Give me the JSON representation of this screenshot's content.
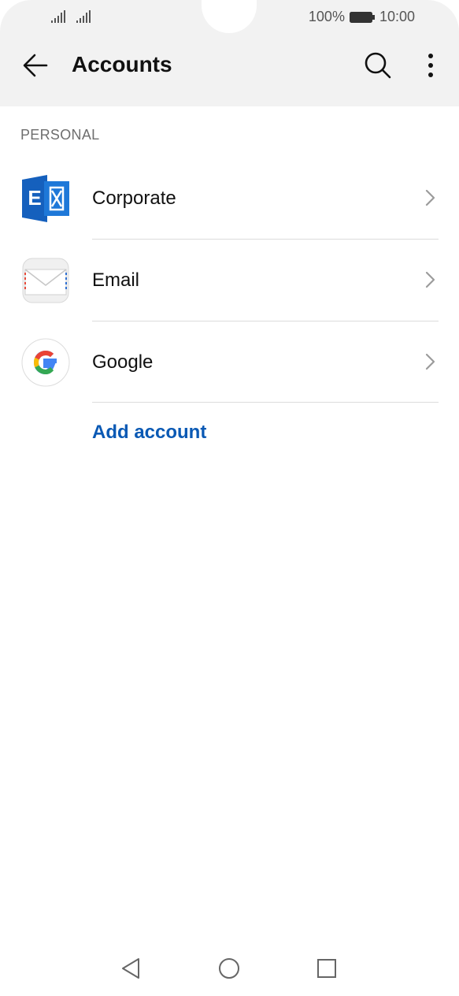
{
  "status_bar": {
    "battery_percent": "100%",
    "time": "10:00"
  },
  "appbar": {
    "title": "Accounts",
    "icons": [
      "back-arrow-icon",
      "search-icon",
      "more-options-icon"
    ]
  },
  "section": {
    "header": "PERSONAL"
  },
  "accounts": [
    {
      "label": "Corporate",
      "icon": "exchange-icon"
    },
    {
      "label": "Email",
      "icon": "envelope-icon"
    },
    {
      "label": "Google",
      "icon": "google-icon"
    }
  ],
  "add_account_label": "Add account",
  "colors": {
    "accent": "#0a59b4",
    "exchange_blue": "#1560bd",
    "google_blue": "#4285f4",
    "google_red": "#ea4335",
    "google_yellow": "#fbbc05",
    "google_green": "#34a853"
  },
  "navbar": {
    "icons": [
      "nav-back-icon",
      "nav-home-icon",
      "nav-recents-icon"
    ]
  }
}
